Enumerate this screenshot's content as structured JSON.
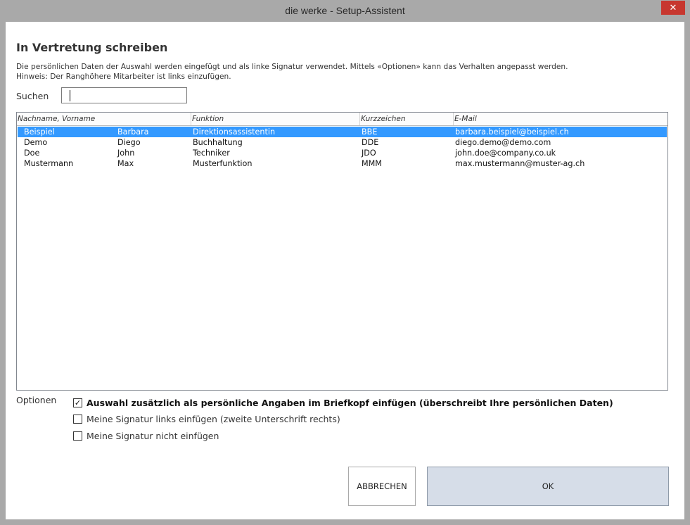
{
  "window": {
    "title": "die werke - Setup-Assistent",
    "close_glyph": "✕"
  },
  "page": {
    "heading": "In Vertretung schreiben",
    "description_line1": "Die persönlichen Daten der Auswahl werden eingefügt und als linke Signatur verwendet. Mittels «Optionen» kann das Verhalten angepasst werden.",
    "description_line2": "Hinweis: Der Ranghöhere Mitarbeiter ist links einzufügen."
  },
  "search": {
    "label": "Suchen",
    "value": ""
  },
  "list": {
    "columns": [
      "Nachname, Vorname",
      "Funktion",
      "Kurzzeichen",
      "E-Mail"
    ],
    "rows": [
      {
        "lastname": "Beispiel",
        "firstname": "Barbara",
        "function": "Direktionsassistentin",
        "short": "BBE",
        "email": "barbara.beispiel@beispiel.ch",
        "selected": true
      },
      {
        "lastname": "Demo",
        "firstname": "Diego",
        "function": "Buchhaltung",
        "short": "DDE",
        "email": "diego.demo@demo.com",
        "selected": false
      },
      {
        "lastname": "Doe",
        "firstname": "John",
        "function": "Techniker",
        "short": "JDO",
        "email": "john.doe@company.co.uk",
        "selected": false
      },
      {
        "lastname": "Mustermann",
        "firstname": "Max",
        "function": "Musterfunktion",
        "short": "MMM",
        "email": "max.mustermann@muster-ag.ch",
        "selected": false
      }
    ]
  },
  "options": {
    "label": "Optionen",
    "items": [
      {
        "label": "Auswahl zusätzlich  als persönliche Angaben im Briefkopf einfügen (überschreibt Ihre persönlichen Daten)",
        "checked": true
      },
      {
        "label": "Meine Signatur links einfügen (zweite Unterschrift rechts)",
        "checked": false
      },
      {
        "label": "Meine Signatur nicht einfügen",
        "checked": false
      }
    ]
  },
  "buttons": {
    "cancel": "ABBRECHEN",
    "ok": "OK"
  },
  "colors": {
    "selection": "#3399ff",
    "close_button": "#c7372f",
    "ok_button": "#d6dde8"
  }
}
